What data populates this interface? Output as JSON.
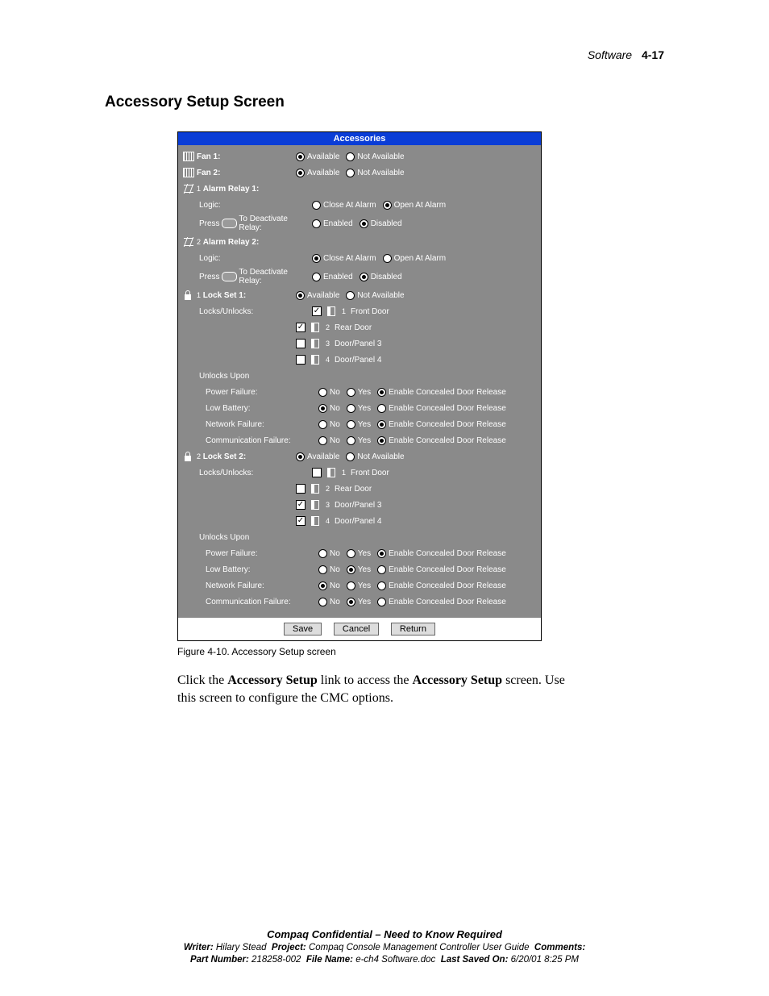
{
  "header": {
    "software": "Software",
    "page": "4-17"
  },
  "title": "Accessory Setup Screen",
  "window_title": "Accessories",
  "opt": {
    "available": "Available",
    "not_available": "Not Available",
    "close_at_alarm": "Close At Alarm",
    "open_at_alarm": "Open At Alarm",
    "enabled": "Enabled",
    "disabled": "Disabled",
    "no": "No",
    "yes": "Yes",
    "ecdr": "Enable Concealed Door Release"
  },
  "doors": {
    "d1": "Front Door",
    "d2": "Rear Door",
    "d3": "Door/Panel 3",
    "d4": "Door/Panel 4"
  },
  "labels": {
    "fan1": "Fan 1:",
    "fan2": "Fan 2:",
    "alarm_relay1": "Alarm Relay 1:",
    "alarm_relay2": "Alarm Relay 2:",
    "logic": "Logic:",
    "press_to_deact_pre": "Press",
    "press_to_deact_post": "To Deactivate Relay:",
    "lockset1": "Lock Set 1:",
    "lockset2": "Lock Set 2:",
    "locks_unlocks": "Locks/Unlocks:",
    "unlocks_upon": "Unlocks Upon",
    "power_failure": "Power Failure:",
    "low_battery": "Low Battery:",
    "network_failure": "Network Failure:",
    "comm_failure": "Communication Failure:"
  },
  "buttons": {
    "save": "Save",
    "cancel": "Cancel",
    "return": "Return"
  },
  "caption": "Figure 4-10.  Accessory Setup screen",
  "body": {
    "pre": "Click the ",
    "link": "Accessory Setup",
    "mid": " link to access the ",
    "screen": "Accessory Setup",
    "post": " screen. Use this screen to configure the CMC options."
  },
  "footer": {
    "line1": "Compaq Confidential – Need to Know Required",
    "writer_k": "Writer:",
    "writer_v": "Hilary Stead",
    "project_k": "Project:",
    "project_v": "Compaq Console Management Controller User Guide",
    "comments_k": "Comments:",
    "part_k": "Part Number:",
    "part_v": "218258-002",
    "file_k": "File Name:",
    "file_v": "e-ch4 Software.doc",
    "saved_k": "Last Saved On:",
    "saved_v": "6/20/01 8:25 PM"
  },
  "chart_data": {
    "type": "table",
    "title": "Accessories configuration state",
    "fan1": "Available",
    "fan2": "Available",
    "alarm_relay1": {
      "logic": "Open At Alarm",
      "press_to_deactivate": "Disabled"
    },
    "alarm_relay2": {
      "logic": "Close At Alarm",
      "press_to_deactivate": "Disabled"
    },
    "lock_set1": {
      "availability": "Available",
      "locks_unlocks": {
        "Front Door": true,
        "Rear Door": true,
        "Door/Panel 3": false,
        "Door/Panel 4": false
      },
      "unlocks_upon": {
        "Power Failure": "Enable Concealed Door Release",
        "Low Battery": "No",
        "Network Failure": "Enable Concealed Door Release",
        "Communication Failure": "Enable Concealed Door Release"
      }
    },
    "lock_set2": {
      "availability": "Available",
      "locks_unlocks": {
        "Front Door": false,
        "Rear Door": false,
        "Door/Panel 3": true,
        "Door/Panel 4": true
      },
      "unlocks_upon": {
        "Power Failure": "Enable Concealed Door Release",
        "Low Battery": "Yes",
        "Network Failure": "No",
        "Communication Failure": "Yes"
      }
    }
  }
}
